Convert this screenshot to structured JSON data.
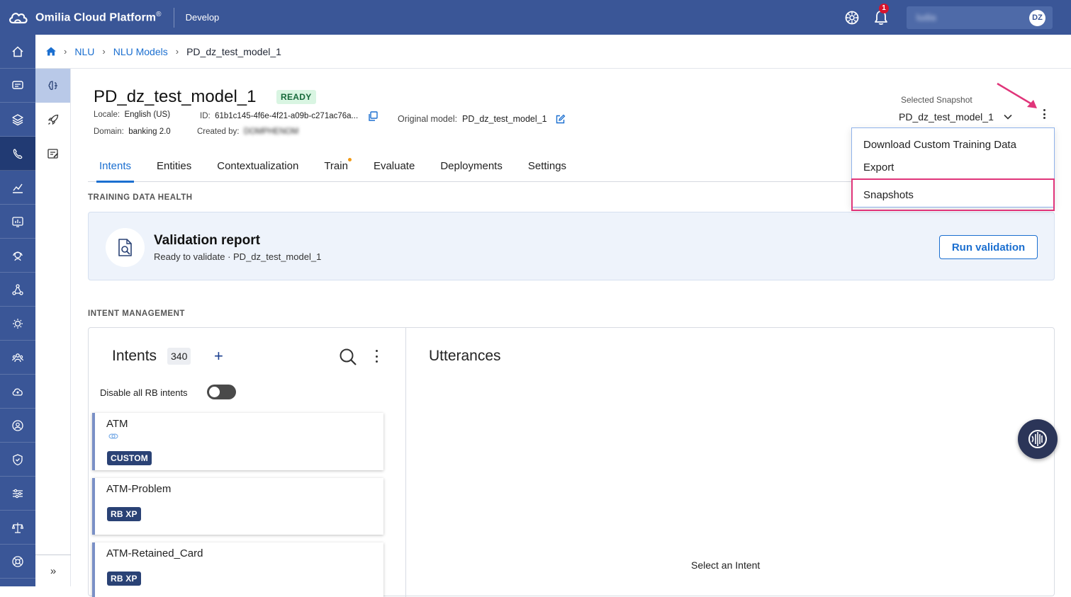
{
  "topbar": {
    "brand": "Omilia Cloud Platform",
    "brand_mark": "®",
    "environment": "Develop",
    "notification_count": "1",
    "user_name": "ludia",
    "avatar_initials": "DZ"
  },
  "breadcrumb": {
    "items": [
      "NLU",
      "NLU Models"
    ],
    "current": "PD_dz_test_model_1"
  },
  "model": {
    "title": "PD_dz_test_model_1",
    "status": "READY",
    "locale_label": "Locale:",
    "locale_value": "English (US)",
    "id_label": "ID:",
    "id_value": "61b1c145-4f6e-4f21-a09b-c271ac76a...",
    "domain_label": "Domain:",
    "domain_value": "banking 2.0",
    "created_label": "Created by:",
    "created_value": "DOMPHENOM",
    "original_label": "Original model:",
    "original_value": "PD_dz_test_model_1"
  },
  "snapshot": {
    "label": "Selected Snapshot",
    "value": "PD_dz_test_model_1"
  },
  "menu": {
    "items": [
      "Download Custom Training Data",
      "Export",
      "Snapshots"
    ],
    "highlight_color": "#e0357a"
  },
  "tabs": [
    "Intents",
    "Entities",
    "Contextualization",
    "Train",
    "Evaluate",
    "Deployments",
    "Settings"
  ],
  "health": {
    "section": "TRAINING DATA HEALTH",
    "title": "Validation report",
    "subtitle": "Ready to validate · PD_dz_test_model_1",
    "button": "Run validation"
  },
  "intent_mgmt": {
    "section": "INTENT MANAGEMENT",
    "title": "Intents",
    "count": "340",
    "disable_label": "Disable all RB intents",
    "intents": [
      {
        "name": "ATM",
        "badge": "CUSTOM"
      },
      {
        "name": "ATM-Problem",
        "badge": "RB XP"
      },
      {
        "name": "ATM-Retained_Card",
        "badge": "RB XP"
      }
    ],
    "utterances_title": "Utterances",
    "empty_text": "Select an Intent"
  },
  "colors": {
    "brand_blue": "#3a5697",
    "link_blue": "#1b6fd0",
    "ready_bg": "#d9f5e2",
    "badge_bg": "#2a4275"
  }
}
